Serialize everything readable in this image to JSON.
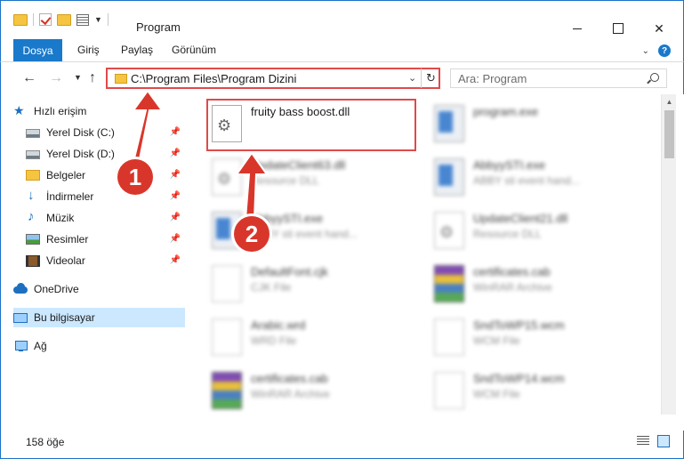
{
  "window": {
    "title": "Program",
    "controls": {
      "minimize": "",
      "maximize": "",
      "close": "✕"
    }
  },
  "ribbon": {
    "tabs": [
      "Dosya",
      "Giriş",
      "Paylaş",
      "Görünüm"
    ],
    "help": "?"
  },
  "address": {
    "path": "C:\\Program Files\\Program Dizini",
    "refresh": "↻",
    "dropdown": "⌄"
  },
  "search": {
    "placeholder": "Ara: Program"
  },
  "sidebar": {
    "quick_access": "Hızlı erişim",
    "items": [
      {
        "label": "Yerel Disk (C:)",
        "icon": "drive-icon",
        "pinned": true
      },
      {
        "label": "Yerel Disk (D:)",
        "icon": "drive-icon",
        "pinned": true
      },
      {
        "label": "Belgeler",
        "icon": "documents-icon",
        "pinned": true
      },
      {
        "label": "İndirmeler",
        "icon": "download-icon",
        "pinned": true
      },
      {
        "label": "Müzik",
        "icon": "music-icon",
        "pinned": true
      },
      {
        "label": "Resimler",
        "icon": "pictures-icon",
        "pinned": true
      },
      {
        "label": "Videolar",
        "icon": "videos-icon",
        "pinned": true
      }
    ],
    "onedrive": "OneDrive",
    "this_pc": "Bu bilgisayar",
    "network": "Ağ"
  },
  "files": [
    {
      "name": "fruity bass boost.dll",
      "type": "",
      "icon": "dll-icon"
    },
    {
      "name": "program.exe",
      "type": "",
      "icon": "exe-icon"
    },
    {
      "name": "UpdateClient63.dll",
      "type": "Resource DLL",
      "icon": "dll-icon"
    },
    {
      "name": "AbbyySTI.exe",
      "type": "ABBY sti event hand...",
      "icon": "exe-icon"
    },
    {
      "name": "AbbyySTI.exe",
      "type": "ABBY sti event hand...",
      "icon": "exe-icon"
    },
    {
      "name": "UpdateClient21.dll",
      "type": "Resource DLL",
      "icon": "dll-icon"
    },
    {
      "name": "DefaultFont.cjk",
      "type": "CJK File",
      "icon": "document-icon"
    },
    {
      "name": "certificates.cab",
      "type": "WinRAR Archive",
      "icon": "archive-icon"
    },
    {
      "name": "Arabic.wrd",
      "type": "WRD File",
      "icon": "document-icon"
    },
    {
      "name": "SndToWP15.wcm",
      "type": "WCM File",
      "icon": "document-icon"
    },
    {
      "name": "certificates.cab",
      "type": "WinRAR Archive",
      "icon": "archive-icon"
    },
    {
      "name": "SndToWP14.wcm",
      "type": "WCM File",
      "icon": "document-icon"
    }
  ],
  "status": {
    "count": "158 öğe"
  },
  "markers": {
    "one": "1",
    "two": "2"
  },
  "colors": {
    "accent": "#1979ca",
    "highlight": "#e04a4a",
    "selection": "#cce8ff"
  }
}
